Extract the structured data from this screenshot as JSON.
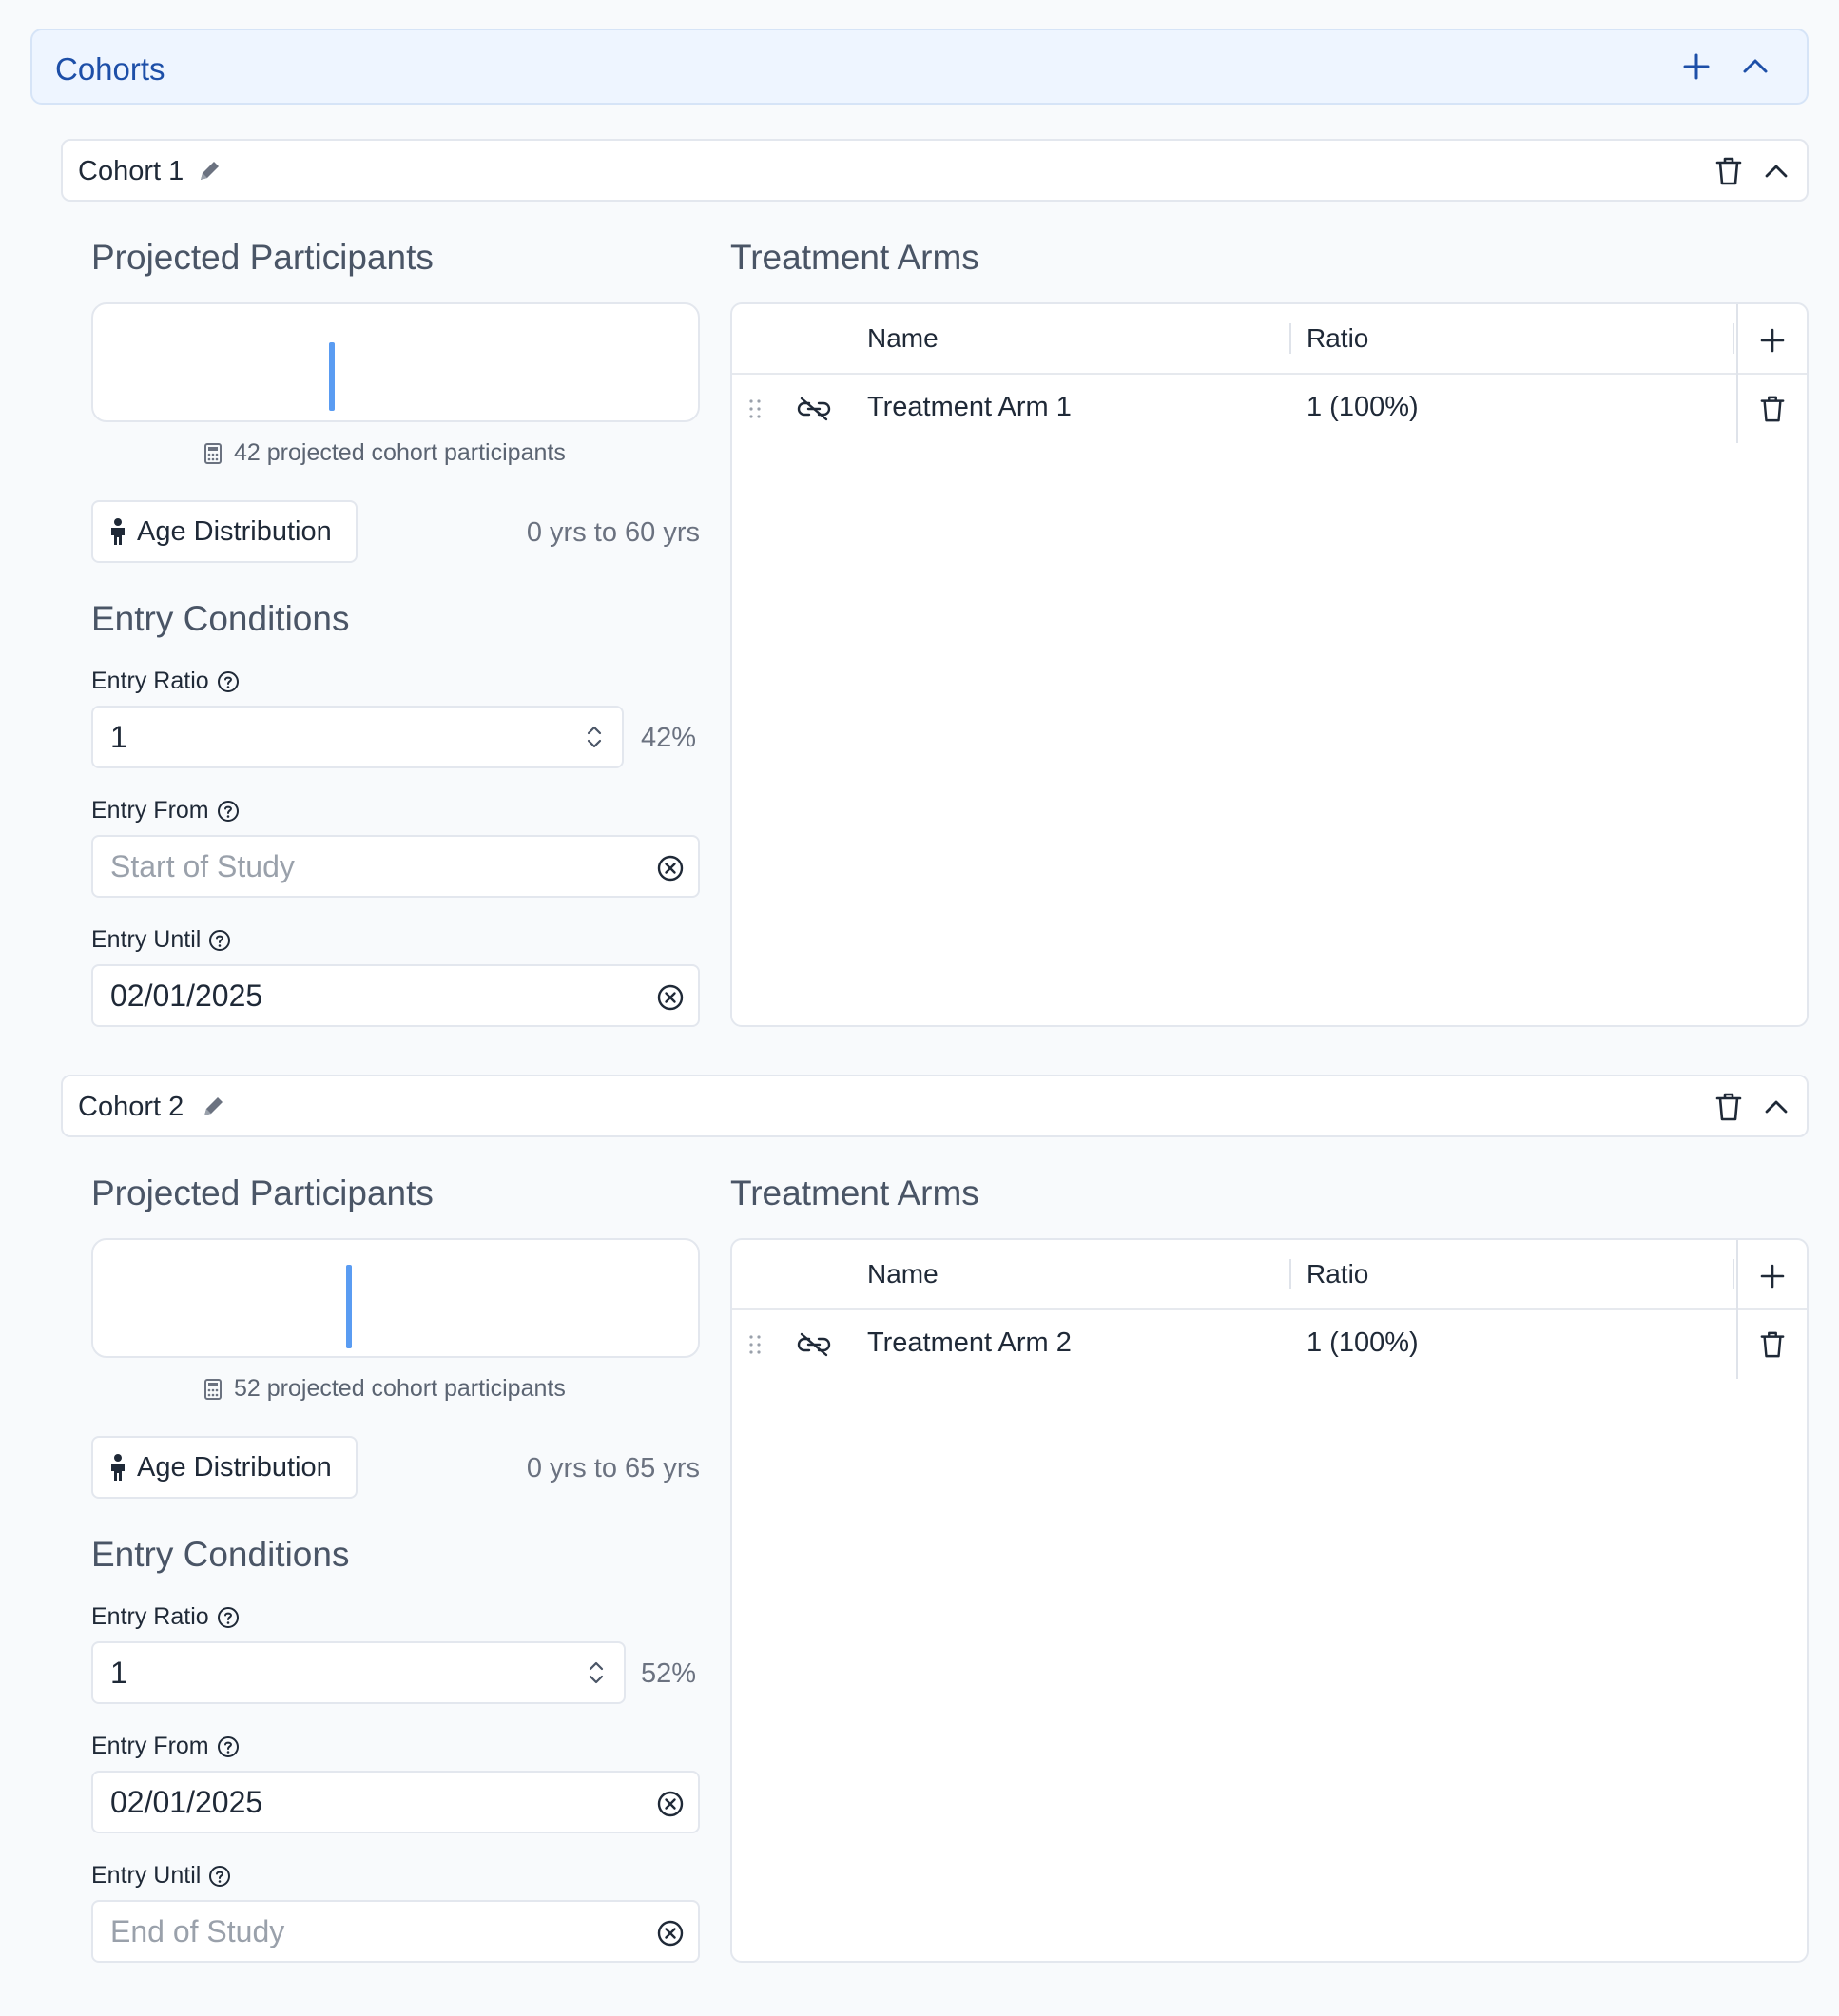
{
  "panel": {
    "title": "Cohorts"
  },
  "cohorts": [
    {
      "name": "Cohort 1",
      "projected_title": "Projected Participants",
      "participants_text": "42 projected cohort participants",
      "age_button": "Age Distribution",
      "age_range": "0 yrs to 60 yrs",
      "entry_title": "Entry Conditions",
      "entry_ratio_label": "Entry Ratio",
      "entry_ratio_value": "1",
      "entry_ratio_pct": "42%",
      "entry_from_label": "Entry From",
      "entry_from_value": "Start of Study",
      "entry_until_label": "Entry Until",
      "entry_until_value": "02/01/2025",
      "arms_title": "Treatment Arms",
      "arms_columns": {
        "name": "Name",
        "ratio": "Ratio"
      },
      "arms": [
        {
          "name": "Treatment Arm 1",
          "ratio": "1 (100%)"
        }
      ]
    },
    {
      "name": "Cohort 2",
      "projected_title": "Projected Participants",
      "participants_text": "52 projected cohort participants",
      "age_button": "Age Distribution",
      "age_range": "0 yrs to 65 yrs",
      "entry_title": "Entry Conditions",
      "entry_ratio_label": "Entry Ratio",
      "entry_ratio_value": "1",
      "entry_ratio_pct": "52%",
      "entry_from_label": "Entry From",
      "entry_from_value": "02/01/2025",
      "entry_until_label": "Entry Until",
      "entry_until_value": "End of Study",
      "arms_title": "Treatment Arms",
      "arms_columns": {
        "name": "Name",
        "ratio": "Ratio"
      },
      "arms": [
        {
          "name": "Treatment Arm 2",
          "ratio": "1 (100%)"
        }
      ]
    }
  ],
  "colors": {
    "accent": "#1d4fa8",
    "bar": "#5a9cf2"
  },
  "icons": [
    "plus-icon",
    "chevron-up-icon",
    "pencil-icon",
    "trash-icon",
    "calculator-icon",
    "person-icon",
    "help-icon",
    "clear-icon",
    "spinner-icon",
    "drag-handle-icon",
    "link-off-icon"
  ]
}
